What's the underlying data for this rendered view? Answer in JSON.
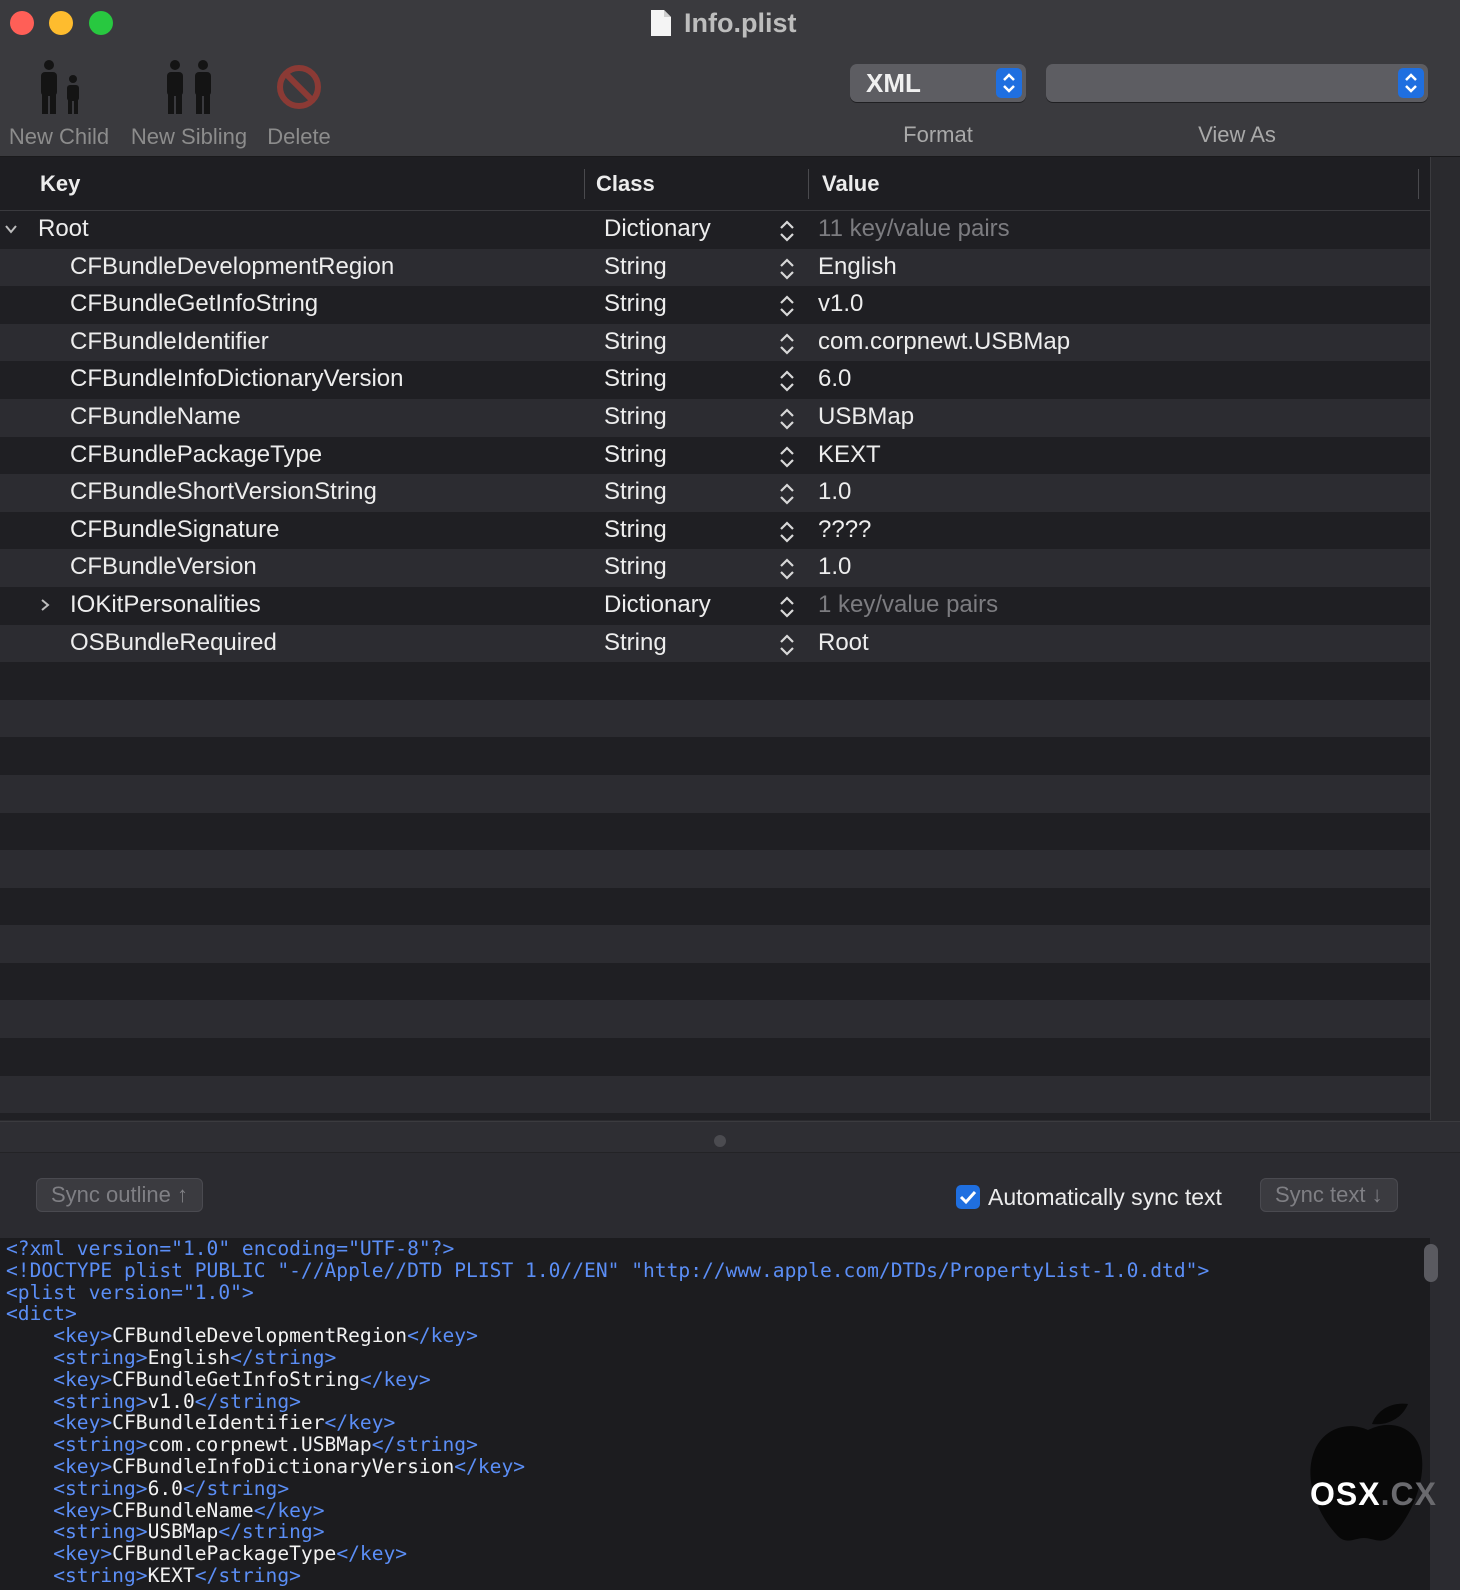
{
  "window": {
    "title": "Info.plist"
  },
  "toolbar": {
    "new_child": "New Child",
    "new_sibling": "New Sibling",
    "delete": "Delete",
    "format_value": "XML",
    "format_label": "Format",
    "view_as_value": "",
    "view_as_label": "View As"
  },
  "table": {
    "headers": {
      "key": "Key",
      "class": "Class",
      "value": "Value"
    },
    "rows": [
      {
        "key": "Root",
        "class": "Dictionary",
        "value": "11 key/value pairs",
        "dim": true,
        "indent": 0,
        "disclosure": "expanded"
      },
      {
        "key": "CFBundleDevelopmentRegion",
        "class": "String",
        "value": "English",
        "dim": false,
        "indent": 1,
        "disclosure": "none"
      },
      {
        "key": "CFBundleGetInfoString",
        "class": "String",
        "value": "v1.0",
        "dim": false,
        "indent": 1,
        "disclosure": "none"
      },
      {
        "key": "CFBundleIdentifier",
        "class": "String",
        "value": "com.corpnewt.USBMap",
        "dim": false,
        "indent": 1,
        "disclosure": "none"
      },
      {
        "key": "CFBundleInfoDictionaryVersion",
        "class": "String",
        "value": "6.0",
        "dim": false,
        "indent": 1,
        "disclosure": "none"
      },
      {
        "key": "CFBundleName",
        "class": "String",
        "value": "USBMap",
        "dim": false,
        "indent": 1,
        "disclosure": "none"
      },
      {
        "key": "CFBundlePackageType",
        "class": "String",
        "value": "KEXT",
        "dim": false,
        "indent": 1,
        "disclosure": "none"
      },
      {
        "key": "CFBundleShortVersionString",
        "class": "String",
        "value": "1.0",
        "dim": false,
        "indent": 1,
        "disclosure": "none"
      },
      {
        "key": "CFBundleSignature",
        "class": "String",
        "value": "????",
        "dim": false,
        "indent": 1,
        "disclosure": "none"
      },
      {
        "key": "CFBundleVersion",
        "class": "String",
        "value": "1.0",
        "dim": false,
        "indent": 1,
        "disclosure": "none"
      },
      {
        "key": "IOKitPersonalities",
        "class": "Dictionary",
        "value": "1 key/value pairs",
        "dim": true,
        "indent": 1,
        "disclosure": "collapsed"
      },
      {
        "key": "OSBundleRequired",
        "class": "String",
        "value": "Root",
        "dim": false,
        "indent": 1,
        "disclosure": "none"
      }
    ],
    "empty_rows": 12
  },
  "sync": {
    "sync_outline": "Sync outline ↑",
    "auto_sync_label": "Automatically sync text",
    "auto_sync_checked": true,
    "sync_text": "Sync text ↓"
  },
  "code_lines": [
    [
      [
        "t",
        "<?xml version=\"1.0\" encoding=\"UTF-8\"?>"
      ]
    ],
    [
      [
        "t",
        "<!DOCTYPE plist PUBLIC \"-//Apple//DTD PLIST 1.0//EN\" \"http://www.apple.com/DTDs/PropertyList-1.0.dtd\">"
      ]
    ],
    [
      [
        "t",
        "<plist version=\"1.0\">"
      ]
    ],
    [
      [
        "t",
        "<dict>"
      ]
    ],
    [
      [
        "w",
        "    "
      ],
      [
        "t",
        "<key>"
      ],
      [
        "w",
        "CFBundleDevelopmentRegion"
      ],
      [
        "t",
        "</key>"
      ]
    ],
    [
      [
        "w",
        "    "
      ],
      [
        "t",
        "<string>"
      ],
      [
        "w",
        "English"
      ],
      [
        "t",
        "</string>"
      ]
    ],
    [
      [
        "w",
        "    "
      ],
      [
        "t",
        "<key>"
      ],
      [
        "w",
        "CFBundleGetInfoString"
      ],
      [
        "t",
        "</key>"
      ]
    ],
    [
      [
        "w",
        "    "
      ],
      [
        "t",
        "<string>"
      ],
      [
        "w",
        "v1.0"
      ],
      [
        "t",
        "</string>"
      ]
    ],
    [
      [
        "w",
        "    "
      ],
      [
        "t",
        "<key>"
      ],
      [
        "w",
        "CFBundleIdentifier"
      ],
      [
        "t",
        "</key>"
      ]
    ],
    [
      [
        "w",
        "    "
      ],
      [
        "t",
        "<string>"
      ],
      [
        "w",
        "com.corpnewt.USBMap"
      ],
      [
        "t",
        "</string>"
      ]
    ],
    [
      [
        "w",
        "    "
      ],
      [
        "t",
        "<key>"
      ],
      [
        "w",
        "CFBundleInfoDictionaryVersion"
      ],
      [
        "t",
        "</key>"
      ]
    ],
    [
      [
        "w",
        "    "
      ],
      [
        "t",
        "<string>"
      ],
      [
        "w",
        "6.0"
      ],
      [
        "t",
        "</string>"
      ]
    ],
    [
      [
        "w",
        "    "
      ],
      [
        "t",
        "<key>"
      ],
      [
        "w",
        "CFBundleName"
      ],
      [
        "t",
        "</key>"
      ]
    ],
    [
      [
        "w",
        "    "
      ],
      [
        "t",
        "<string>"
      ],
      [
        "w",
        "USBMap"
      ],
      [
        "t",
        "</string>"
      ]
    ],
    [
      [
        "w",
        "    "
      ],
      [
        "t",
        "<key>"
      ],
      [
        "w",
        "CFBundlePackageType"
      ],
      [
        "t",
        "</key>"
      ]
    ],
    [
      [
        "w",
        "    "
      ],
      [
        "t",
        "<string>"
      ],
      [
        "w",
        "KEXT"
      ],
      [
        "t",
        "</string>"
      ]
    ]
  ],
  "watermark": {
    "text_a": "OSX",
    "text_b": ".CX"
  },
  "colors": {
    "accent": "#1f6fe0",
    "tag": "#5b8ef6",
    "close": "#ff5f57",
    "minimize": "#febc2e",
    "zoom": "#28c840"
  }
}
